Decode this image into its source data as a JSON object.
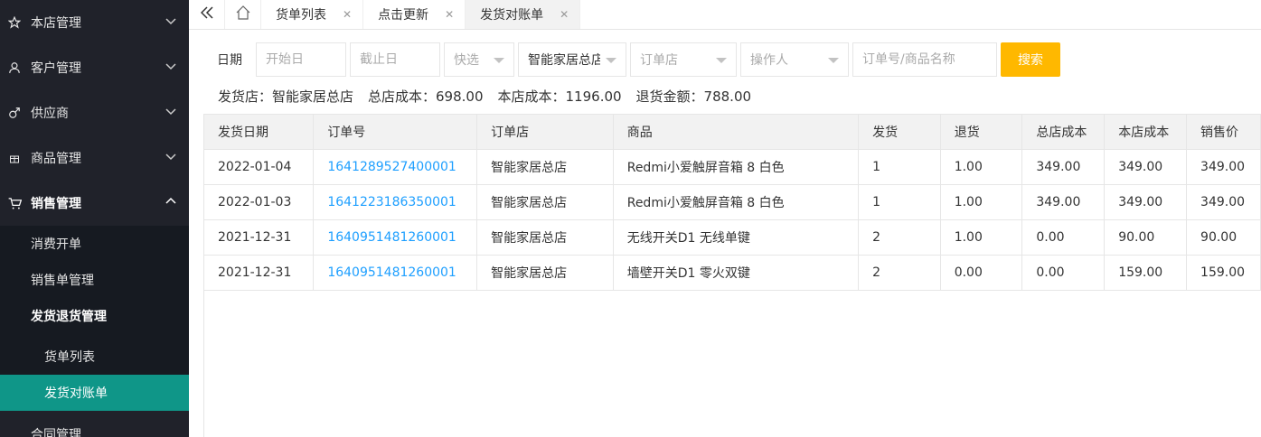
{
  "sidebar": {
    "menus": [
      {
        "label": "本店管理",
        "icon": "star-icon"
      },
      {
        "label": "客户管理",
        "icon": "user-icon"
      },
      {
        "label": "供应商",
        "icon": "male-icon"
      },
      {
        "label": "商品管理",
        "icon": "gift-icon"
      },
      {
        "label": "销售管理",
        "icon": "cart-icon"
      }
    ],
    "sales_sub": [
      "消费开单",
      "销售单管理",
      "发货退货管理"
    ],
    "ship_sub": [
      "货单列表",
      "发货对账单"
    ],
    "bottom": "合同管理"
  },
  "tabs": [
    {
      "label": "货单列表"
    },
    {
      "label": "点击更新"
    },
    {
      "label": "发货对账单"
    }
  ],
  "filters": {
    "date_label": "日期",
    "start_placeholder": "开始日",
    "end_placeholder": "截止日",
    "quick": "快选",
    "store": "智能家居总店",
    "order_store": "订单店",
    "operator": "操作人",
    "keyword_placeholder": "订单号/商品名称",
    "search": "搜索"
  },
  "summary": {
    "ship_store": "发货店：智能家居总店",
    "hq_cost": "总店成本：698.00",
    "store_cost": "本店成本：1196.00",
    "refund": "退货金额：788.00"
  },
  "table": {
    "columns": [
      "发货日期",
      "订单号",
      "订单店",
      "商品",
      "发货",
      "退货",
      "总店成本",
      "本店成本",
      "销售价"
    ],
    "rows": [
      [
        "2022-01-04",
        "1641289527400001",
        "智能家居总店",
        "Redmi小爱触屏音箱 8 白色",
        "1",
        "1.00",
        "349.00",
        "349.00",
        "349.00"
      ],
      [
        "2022-01-03",
        "1641223186350001",
        "智能家居总店",
        "Redmi小爱触屏音箱 8 白色",
        "1",
        "1.00",
        "349.00",
        "349.00",
        "349.00"
      ],
      [
        "2021-12-31",
        "1640951481260001",
        "智能家居总店",
        "无线开关D1 无线单键",
        "2",
        "1.00",
        "0.00",
        "90.00",
        "90.00"
      ],
      [
        "2021-12-31",
        "1640951481260001",
        "智能家居总店",
        "墙壁开关D1 零火双键",
        "2",
        "0.00",
        "0.00",
        "159.00",
        "159.00"
      ]
    ]
  },
  "colors": {
    "sidebar_bg": "#20222a",
    "submenu_bg": "#161a21",
    "active_green": "#0f9688",
    "search_btn": "#ffb800",
    "link_blue": "#1e9fff"
  }
}
